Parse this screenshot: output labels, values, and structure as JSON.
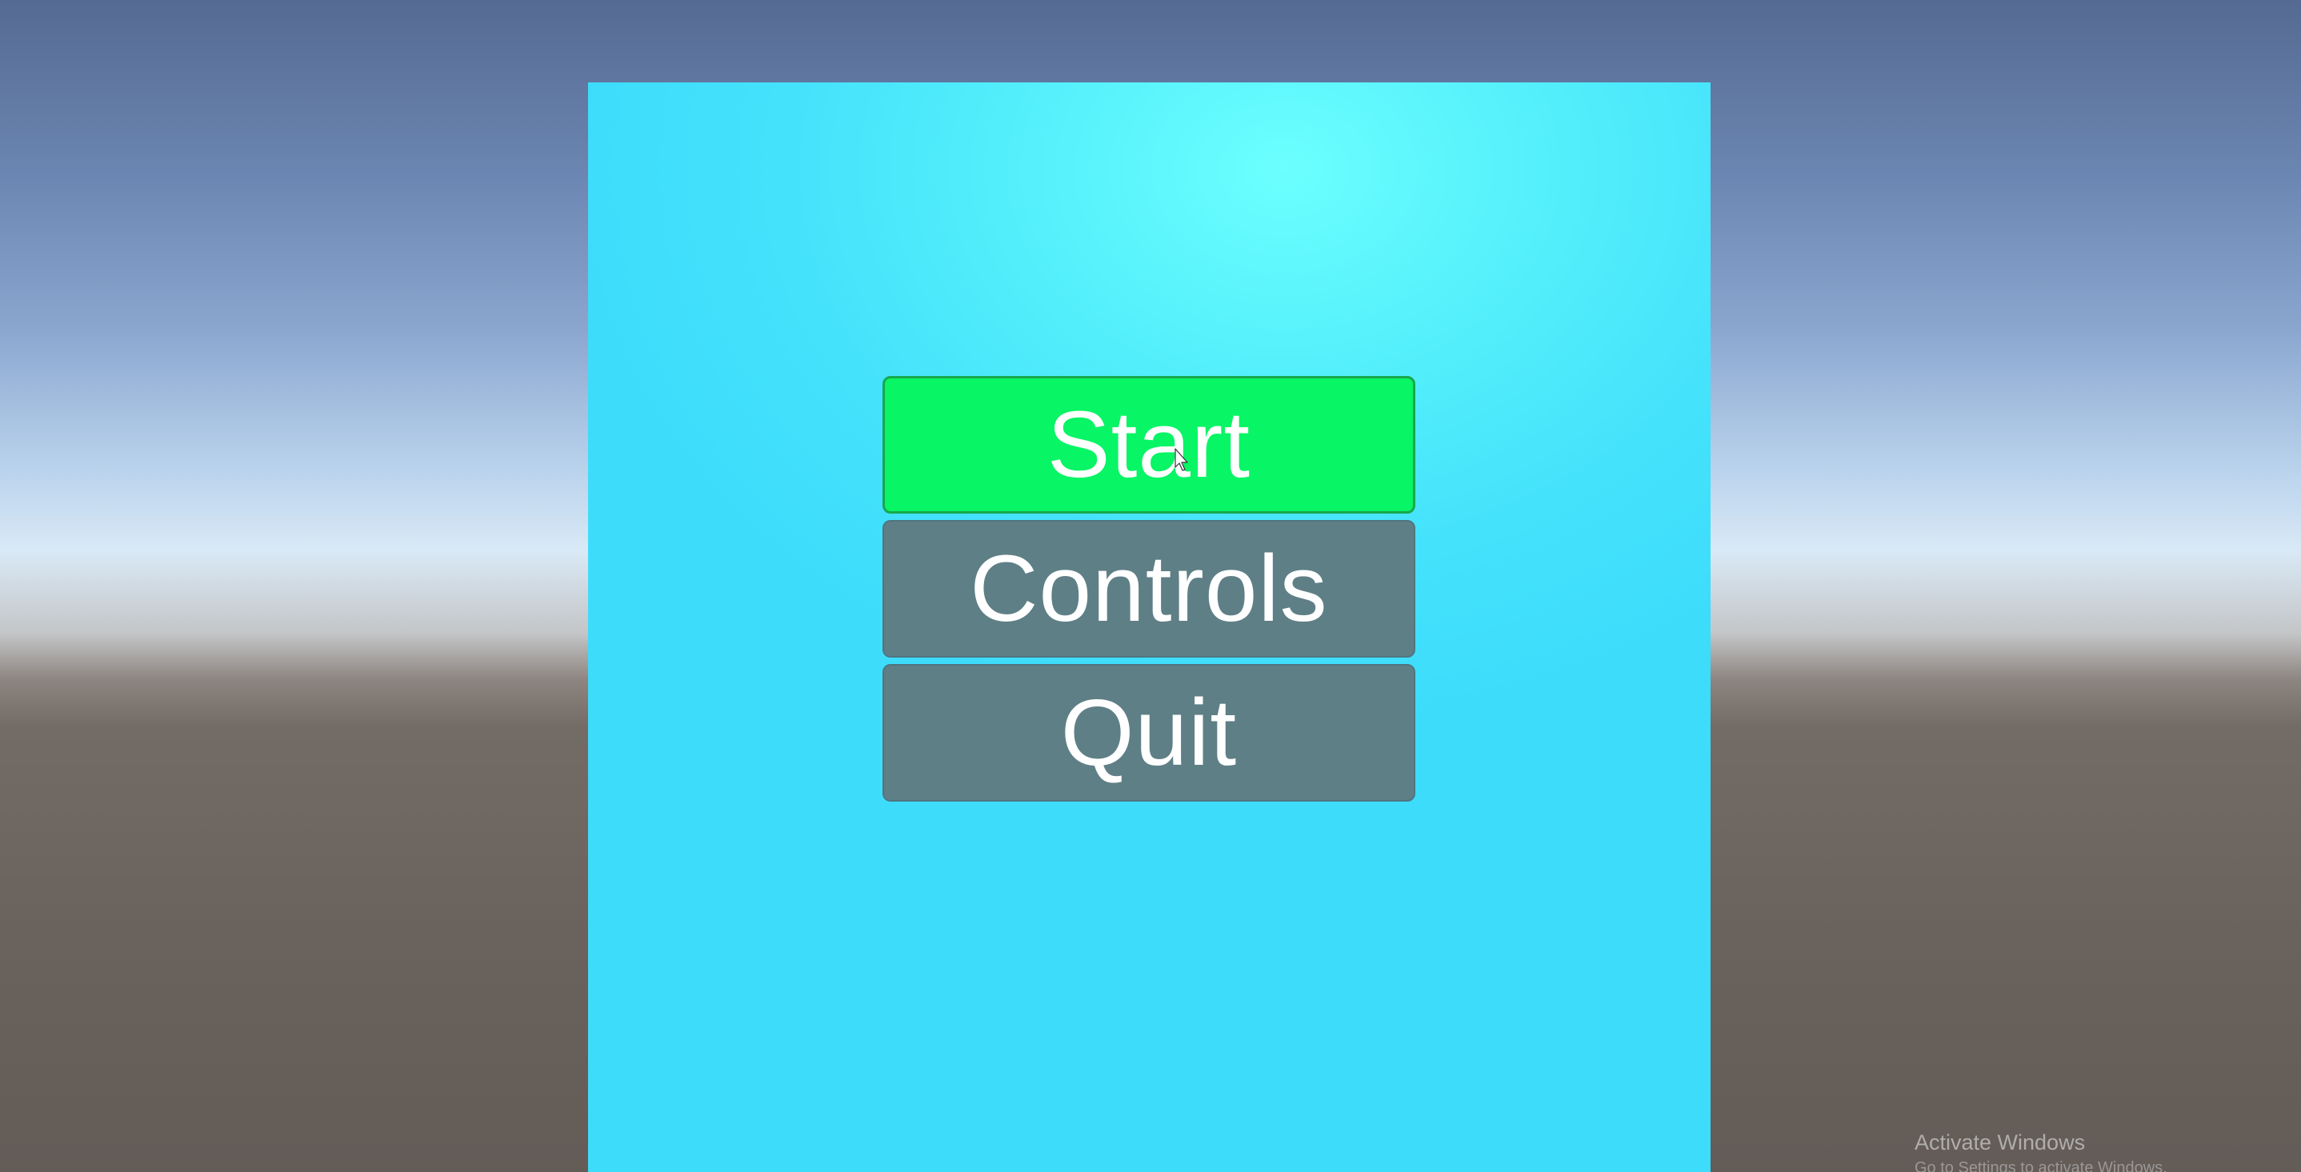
{
  "menu": {
    "buttons": [
      {
        "label": "Start",
        "color": "#08f565",
        "state": "hovered"
      },
      {
        "label": "Controls",
        "color": "#5f7f86"
      },
      {
        "label": "Quit",
        "color": "#5f7f86"
      }
    ],
    "panel_color": "#40dcfb"
  },
  "watermark": {
    "title": "Activate Windows",
    "subtitle": "Go to Settings to activate Windows."
  },
  "icons": {
    "cursor": "mouse-pointer-icon"
  }
}
